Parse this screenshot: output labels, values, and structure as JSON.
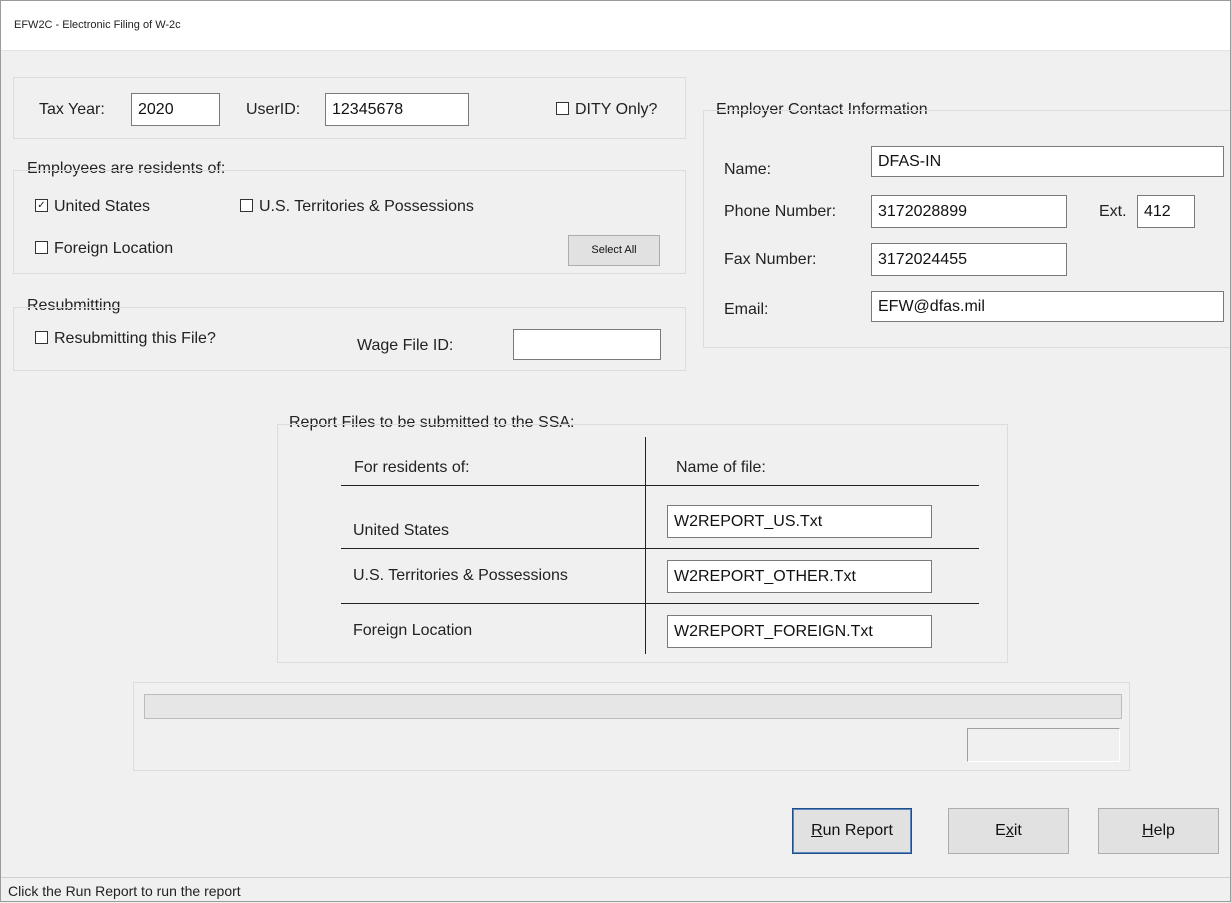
{
  "window": {
    "title": "EFW2C - Electronic Filing of W-2c"
  },
  "top_group": {
    "tax_year_label": "Tax Year:",
    "tax_year_value": "2020",
    "userid_label": "UserID:",
    "userid_value": "12345678",
    "dity_label": "DITY Only?",
    "dity_checked": false
  },
  "residents": {
    "heading": "Employees are residents of:",
    "united_states_label": "United States",
    "united_states_checked": true,
    "territories_label": "U.S. Territories & Possessions",
    "territories_checked": false,
    "foreign_label": "Foreign Location",
    "foreign_checked": false,
    "select_all_label": "Select All"
  },
  "resubmit": {
    "heading": "Resubmitting",
    "resubmit_label": "Resubmitting this File?",
    "resubmit_checked": false,
    "wage_file_id_label": "Wage File ID:",
    "wage_file_id_value": ""
  },
  "employer": {
    "heading": "Employer Contact Information",
    "name_label": "Name:",
    "name_value": "DFAS-IN",
    "phone_label": "Phone Number:",
    "phone_value": "3172028899",
    "ext_label": "Ext.",
    "ext_value": "412",
    "fax_label": "Fax Number:",
    "fax_value": "3172024455",
    "email_label": "Email:",
    "email_value": "EFW@dfas.mil"
  },
  "report_files": {
    "heading": "Report Files to be submitted to the SSA:",
    "col_residents": "For residents of:",
    "col_file": "Name of file:",
    "rows": [
      {
        "resident": "United States",
        "file": "W2REPORT_US.Txt"
      },
      {
        "resident": "U.S. Territories & Possessions",
        "file": "W2REPORT_OTHER.Txt"
      },
      {
        "resident": "Foreign Location",
        "file": "W2REPORT_FOREIGN.Txt"
      }
    ]
  },
  "progress": {
    "percent": 0,
    "status_value": ""
  },
  "buttons": {
    "run_report_pre": "",
    "run_report_accel": "R",
    "run_report_post": "un Report",
    "exit_pre": "E",
    "exit_accel": "x",
    "exit_post": "it",
    "help_pre": "",
    "help_accel": "H",
    "help_post": "elp"
  },
  "status_bar": {
    "text": "Click the Run Report to run the report"
  }
}
